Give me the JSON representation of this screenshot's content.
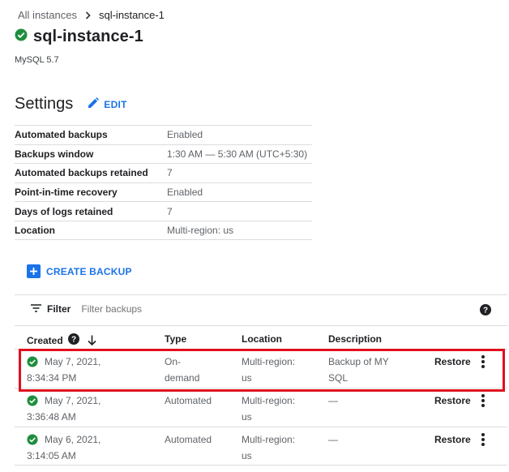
{
  "breadcrumb": {
    "parent": "All instances",
    "current": "sql-instance-1"
  },
  "instance": {
    "name": "sql-instance-1",
    "version": "MySQL 5.7",
    "status_icon": "check-circle-icon"
  },
  "settings": {
    "title": "Settings",
    "edit_label": "EDIT",
    "rows": [
      {
        "key": "Automated backups",
        "value": "Enabled"
      },
      {
        "key": "Backups window",
        "value": "1:30 AM — 5:30 AM (UTC+5:30)"
      },
      {
        "key": "Automated backups retained",
        "value": "7"
      },
      {
        "key": "Point-in-time recovery",
        "value": "Enabled"
      },
      {
        "key": "Days of logs retained",
        "value": "7"
      },
      {
        "key": "Location",
        "value": "Multi-region: us"
      }
    ]
  },
  "create_backup_label": "CREATE BACKUP",
  "filter": {
    "label": "Filter",
    "placeholder": "Filter backups"
  },
  "table": {
    "headers": {
      "created": "Created",
      "type": "Type",
      "location": "Location",
      "description": "Description"
    },
    "rows": [
      {
        "created_date": "May 7, 2021,",
        "created_time": "8:34:34 PM",
        "type_1": "On-",
        "type_2": "demand",
        "location_1": "Multi-region:",
        "location_2": "us",
        "desc_1": "Backup of MY",
        "desc_2": "SQL",
        "action": "Restore"
      },
      {
        "created_date": "May 7, 2021,",
        "created_time": "3:36:48 AM",
        "type_1": "Automated",
        "type_2": "",
        "location_1": "Multi-region:",
        "location_2": "us",
        "desc_1": "—",
        "desc_2": "",
        "action": "Restore"
      },
      {
        "created_date": "May 6, 2021,",
        "created_time": "3:14:05 AM",
        "type_1": "Automated",
        "type_2": "",
        "location_1": "Multi-region:",
        "location_2": "us",
        "desc_1": "—",
        "desc_2": "",
        "action": "Restore"
      }
    ]
  },
  "colors": {
    "accent": "#1a73e8",
    "success": "#1e8e3e",
    "highlight": "#e0101e"
  }
}
